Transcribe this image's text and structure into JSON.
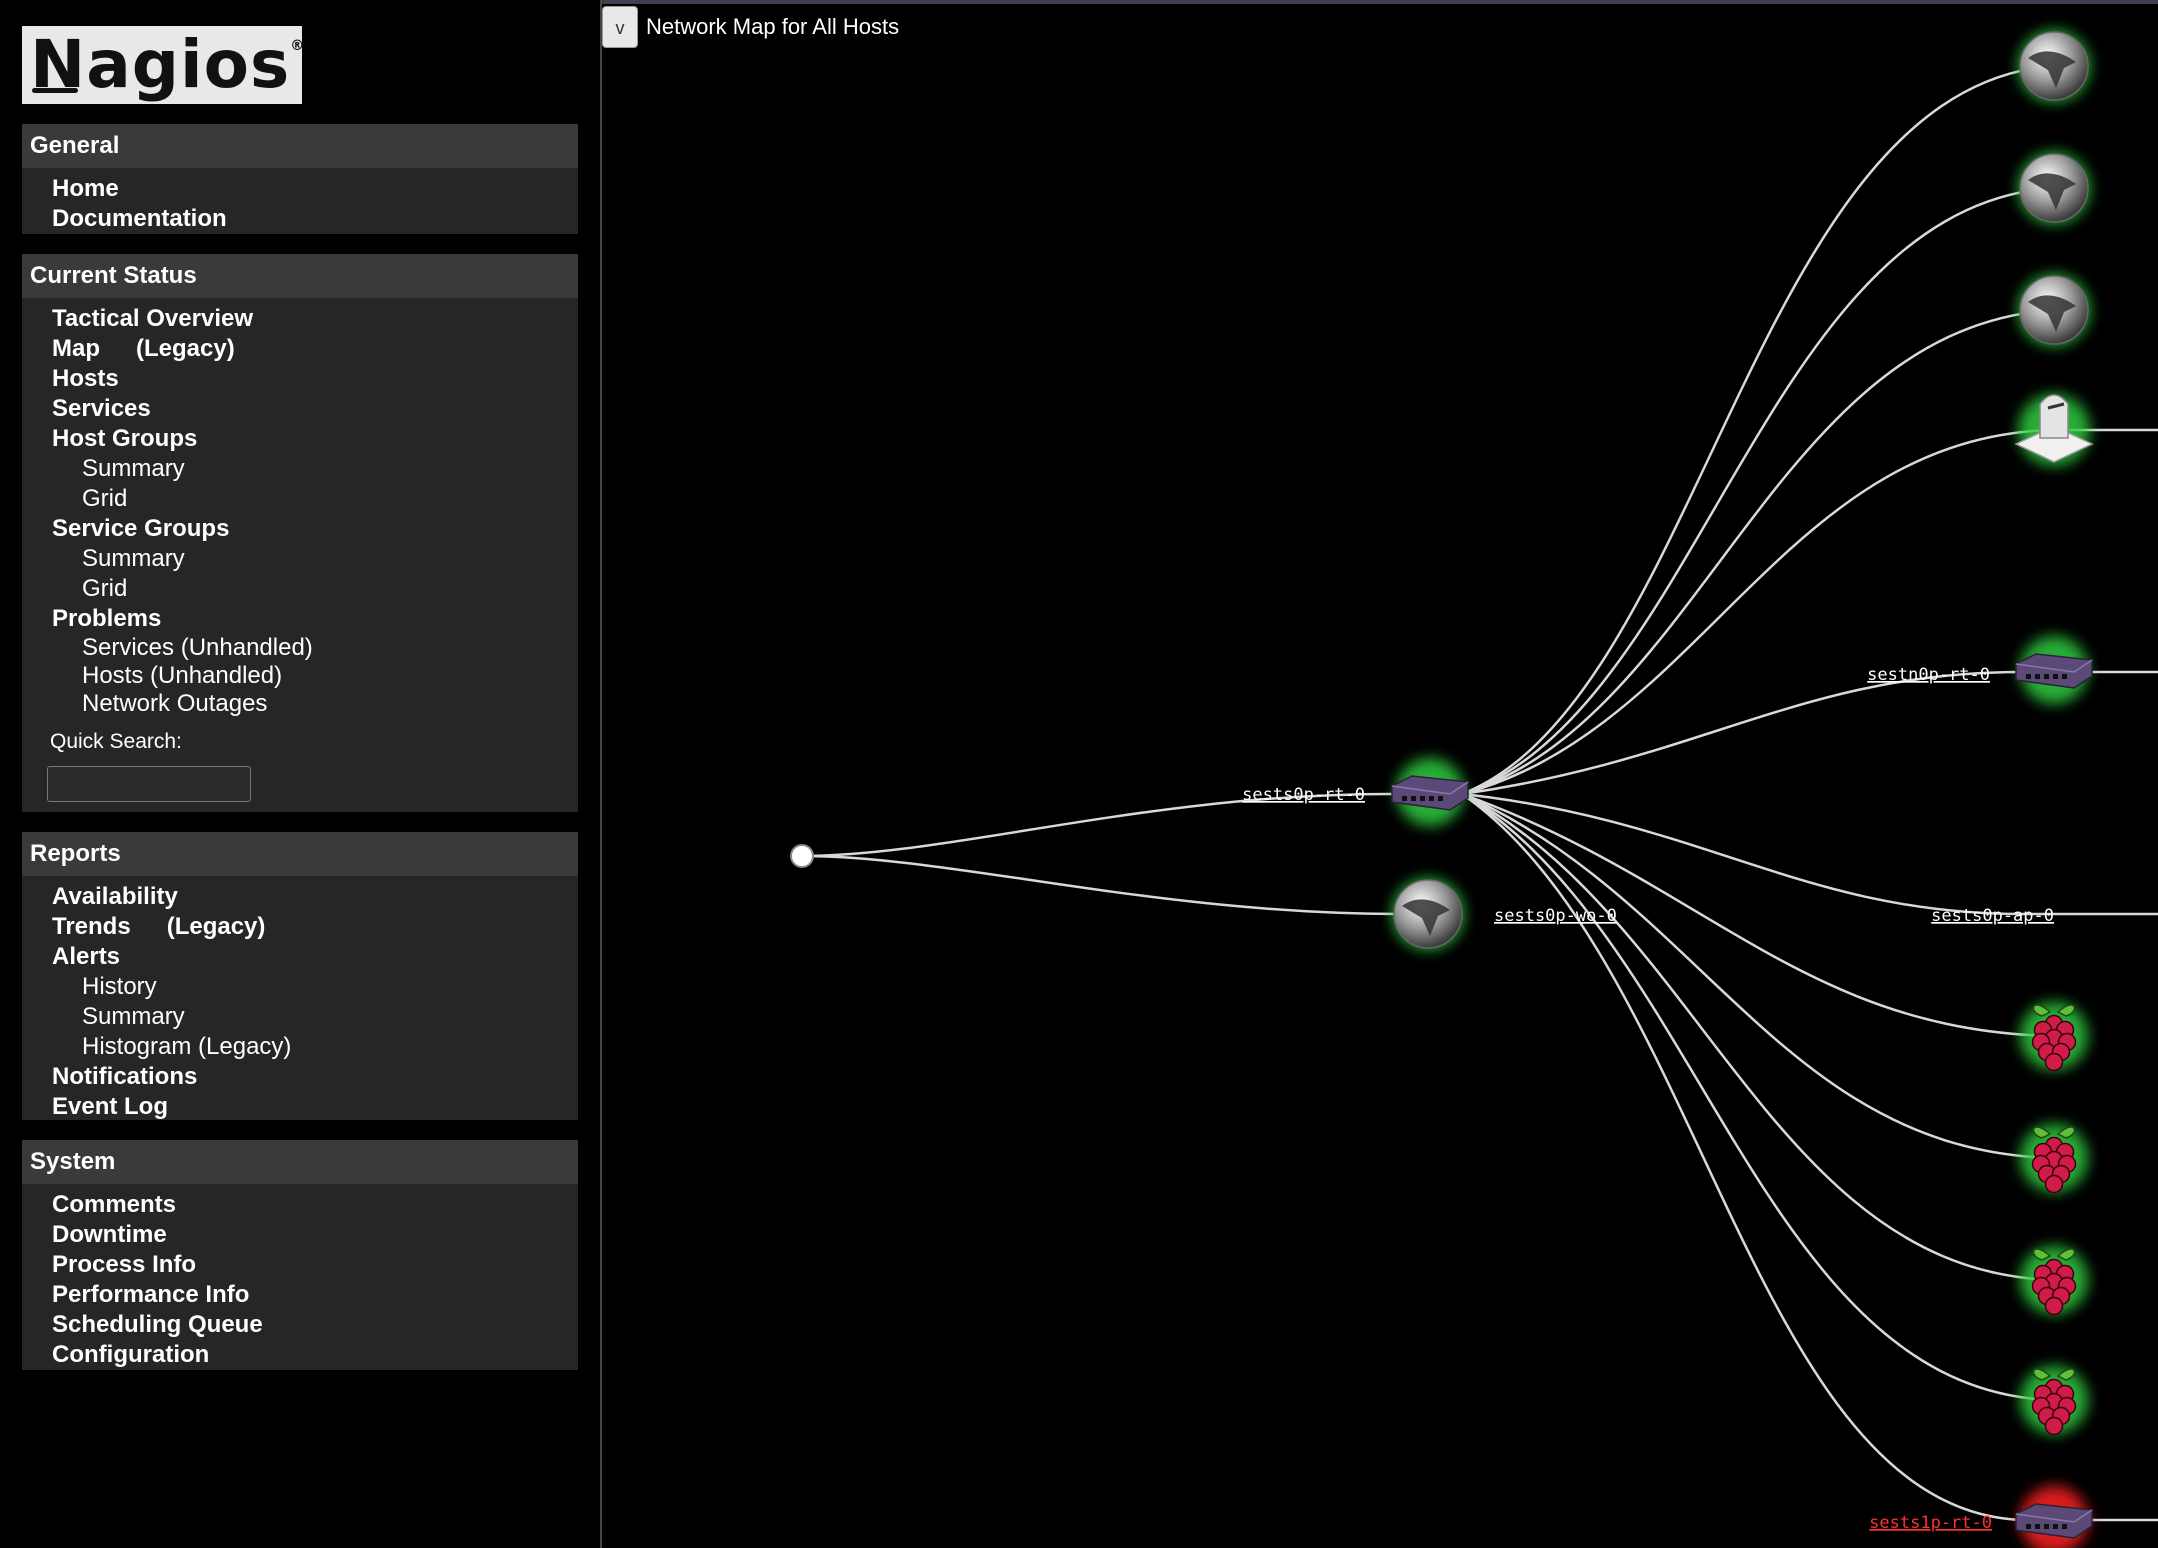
{
  "logo": {
    "text": "Nagios",
    "reg_mark": "®"
  },
  "sidebar": {
    "general": {
      "title": "General",
      "items": [
        "Home",
        "Documentation"
      ]
    },
    "current_status": {
      "title": "Current Status",
      "tactical_overview": "Tactical Overview",
      "map": "Map",
      "map_legacy": "(Legacy)",
      "hosts": "Hosts",
      "services": "Services",
      "host_groups": "Host Groups",
      "host_groups_summary": "Summary",
      "host_groups_grid": "Grid",
      "service_groups": "Service Groups",
      "service_groups_summary": "Summary",
      "service_groups_grid": "Grid",
      "problems": "Problems",
      "problems_services": "Services (Unhandled)",
      "problems_hosts": "Hosts (Unhandled)",
      "problems_outages": "Network Outages",
      "quick_search_label": "Quick Search:",
      "quick_search_value": ""
    },
    "reports": {
      "title": "Reports",
      "availability": "Availability",
      "trends": "Trends",
      "trends_legacy": "(Legacy)",
      "alerts": "Alerts",
      "alerts_history": "History",
      "alerts_summary": "Summary",
      "alerts_histogram": "Histogram (Legacy)",
      "notifications": "Notifications",
      "event_log": "Event Log"
    },
    "system": {
      "title": "System",
      "items": [
        "Comments",
        "Downtime",
        "Process Info",
        "Performance Info",
        "Scheduling Queue",
        "Configuration"
      ]
    }
  },
  "map": {
    "toggle_label": "v",
    "title": "Network Map for All Hosts",
    "hosts": {
      "root_router": "sests0p-rt-0",
      "world": "sests0p-wo-0",
      "router_n": "sestn0p-rt-0",
      "access_point": "sests0p-ap-0",
      "router_1": "sests1p-rt-0"
    },
    "colors": {
      "link": "#d8d8d8",
      "up_glow": "#2ecc40",
      "down_glow": "#ff2020",
      "down_label": "#ff3030",
      "label": "#ffffff"
    }
  }
}
